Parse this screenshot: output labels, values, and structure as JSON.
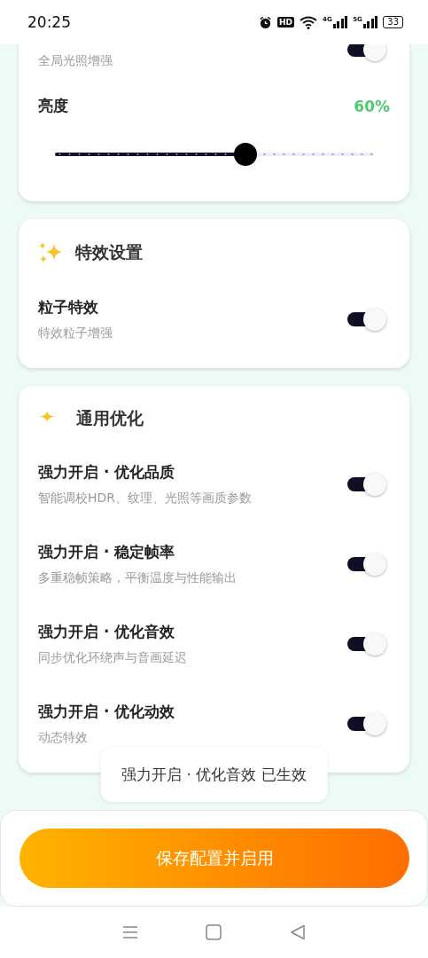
{
  "status_bar": {
    "time": "20:25",
    "hd_label": "HD",
    "signals": [
      {
        "label": "4G"
      },
      {
        "label": "5G"
      }
    ],
    "battery": "33"
  },
  "lighting_card": {
    "rows": [
      {
        "subtitle": "全局光照增强",
        "on": true
      }
    ],
    "brightness": {
      "label": "亮度",
      "reading": "60%",
      "level": 0.6
    }
  },
  "effects_card": {
    "title": "特效设置",
    "rows": [
      {
        "title": "粒子特效",
        "subtitle": "特效粒子增强",
        "on": true
      }
    ]
  },
  "general_card": {
    "title": "通用优化",
    "rows": [
      {
        "title": "强力开启 · 优化品质",
        "subtitle": "智能调校HDR、纹理、光照等画质参数",
        "on": true
      },
      {
        "title": "强力开启 · 稳定帧率",
        "subtitle": "多重稳帧策略，平衡温度与性能输出",
        "on": true
      },
      {
        "title": "强力开启 · 优化音效",
        "subtitle": "同步优化环绕声与音画延迟",
        "on": true
      },
      {
        "title": "强力开启 · 优化动效",
        "subtitle": "动态特效",
        "on": true
      }
    ]
  },
  "toast": "强力开启 · 优化音效 已生效",
  "save_button": "保存配置并启用"
}
